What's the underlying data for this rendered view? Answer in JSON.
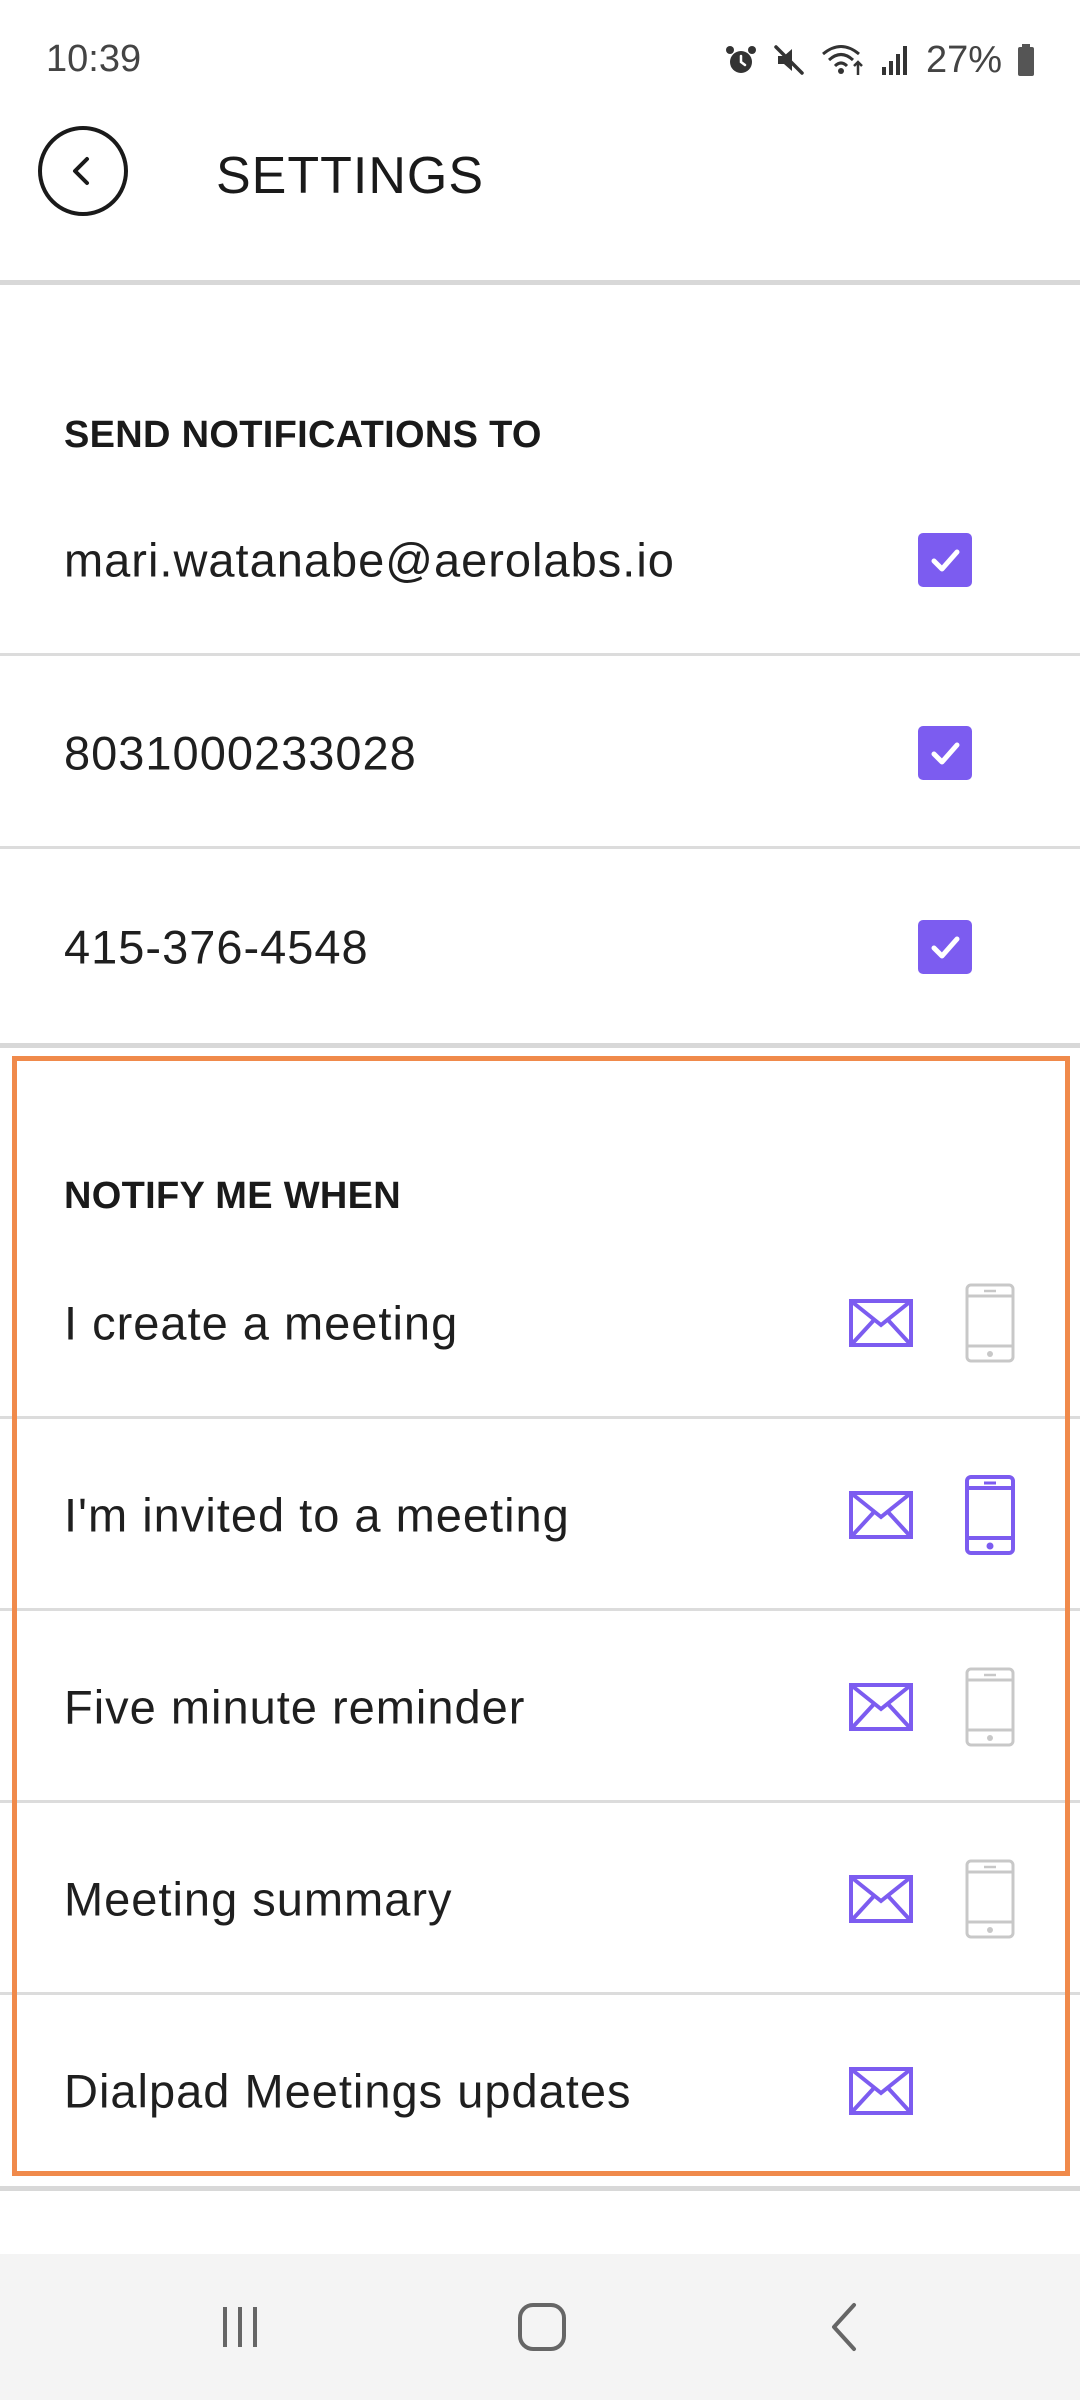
{
  "status_bar": {
    "time": "10:39",
    "battery": "27%",
    "icons": [
      "alarm-icon",
      "mute-icon",
      "wifi-icon",
      "signal-icon",
      "battery-icon"
    ]
  },
  "header": {
    "back_icon": "chevron-left-icon",
    "title": "SETTINGS"
  },
  "send_notifications": {
    "heading": "SEND NOTIFICATIONS TO",
    "items": [
      {
        "label": "mari.watanabe@aerolabs.io",
        "checked": true
      },
      {
        "label": "8031000233028",
        "checked": true
      },
      {
        "label": "415-376-4548",
        "checked": true
      }
    ]
  },
  "notify_me_when": {
    "heading": "NOTIFY ME WHEN",
    "items": [
      {
        "label": "I create a meeting",
        "email": true,
        "phone": false,
        "has_phone": true
      },
      {
        "label": "I'm invited to a meeting",
        "email": true,
        "phone": true,
        "has_phone": true
      },
      {
        "label": "Five minute reminder",
        "email": true,
        "phone": false,
        "has_phone": true
      },
      {
        "label": "Meeting summary",
        "email": true,
        "phone": false,
        "has_phone": true
      },
      {
        "label": "Dialpad Meetings updates",
        "email": true,
        "has_phone": false
      }
    ]
  },
  "colors": {
    "accent": "#7c5cf0",
    "inactive_icon": "#c8c8c8",
    "highlight": "#f08a4b",
    "divider": "#dcdcdc"
  },
  "nav_bar": {
    "buttons": [
      "recents-icon",
      "home-icon",
      "back-icon"
    ]
  }
}
